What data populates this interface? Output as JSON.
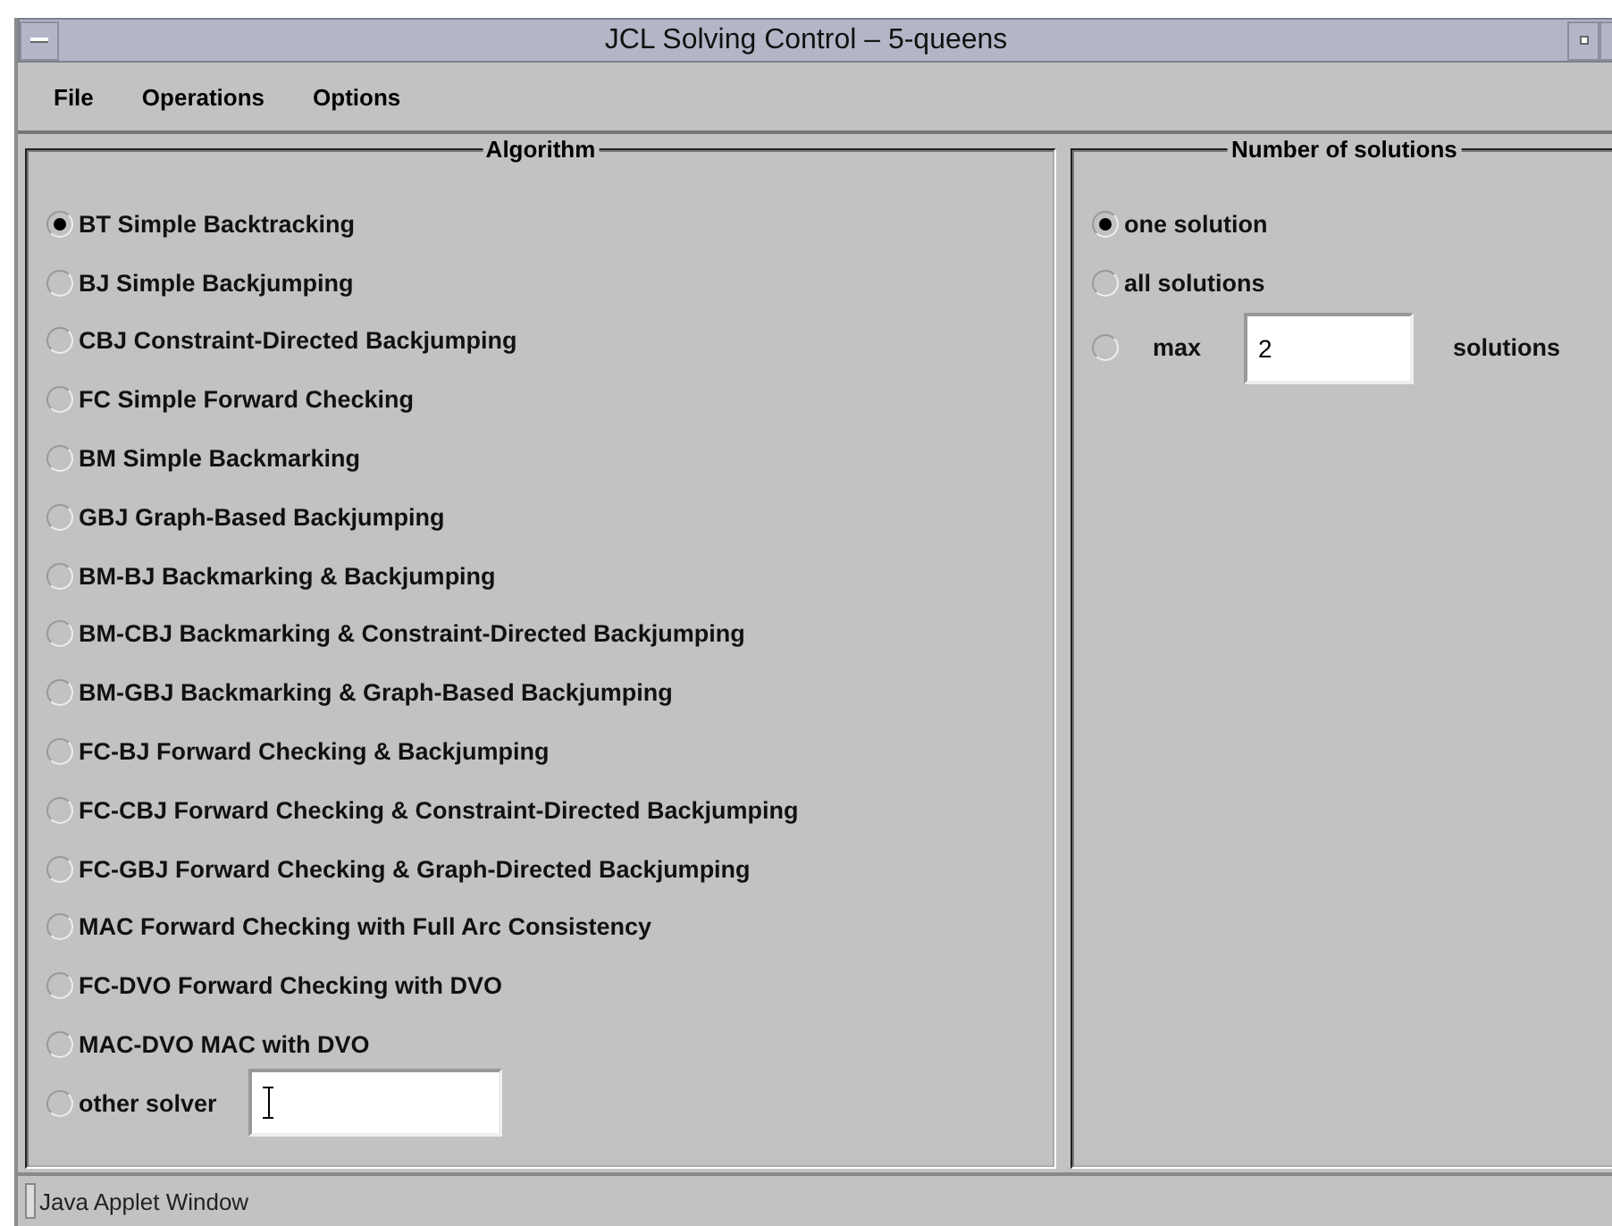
{
  "window": {
    "title": "JCL Solving Control – 5-queens"
  },
  "menu": [
    "File",
    "Operations",
    "Options"
  ],
  "algorithm": {
    "title": "Algorithm",
    "options": [
      {
        "kind": "option",
        "label": "BT Simple Backtracking",
        "selected": true
      },
      {
        "kind": "option",
        "label": "BJ Simple Backjumping",
        "selected": false
      },
      {
        "kind": "option",
        "label": "CBJ Constraint-Directed Backjumping",
        "selected": false
      },
      {
        "kind": "option",
        "label": "FC Simple Forward Checking",
        "selected": false
      },
      {
        "kind": "option",
        "label": "BM Simple Backmarking",
        "selected": false
      },
      {
        "kind": "option",
        "label": "GBJ Graph-Based Backjumping",
        "selected": false
      },
      {
        "kind": "option",
        "label": "BM-BJ Backmarking & Backjumping",
        "selected": false
      },
      {
        "kind": "option",
        "label": "BM-CBJ Backmarking & Constraint-Directed Backjumping",
        "selected": false
      },
      {
        "kind": "option",
        "label": "BM-GBJ Backmarking & Graph-Based Backjumping",
        "selected": false
      },
      {
        "kind": "option",
        "label": "FC-BJ Forward Checking & Backjumping",
        "selected": false
      },
      {
        "kind": "option",
        "label": "FC-CBJ Forward Checking & Constraint-Directed Backjumping",
        "selected": false
      },
      {
        "kind": "option",
        "label": "FC-GBJ Forward Checking & Graph-Directed Backjumping",
        "selected": false
      },
      {
        "kind": "option",
        "label": "MAC Forward Checking with Full Arc Consistency",
        "selected": false
      },
      {
        "kind": "option",
        "label": "FC-DVO Forward Checking with DVO",
        "selected": false
      },
      {
        "kind": "option",
        "label": "MAC-DVO MAC with DVO",
        "selected": false
      },
      {
        "kind": "input",
        "label": "other solver",
        "selected": false
      }
    ]
  },
  "solutions": {
    "title": "Number of solutions",
    "options": [
      {
        "kind": "option",
        "label": "one solution",
        "selected": true
      },
      {
        "kind": "option",
        "label": "all solutions",
        "selected": false
      },
      {
        "kind": "max",
        "label": "max",
        "value": "2",
        "suffix": "solutions",
        "selected": false
      }
    ]
  },
  "status_bar": "Java Applet Window"
}
